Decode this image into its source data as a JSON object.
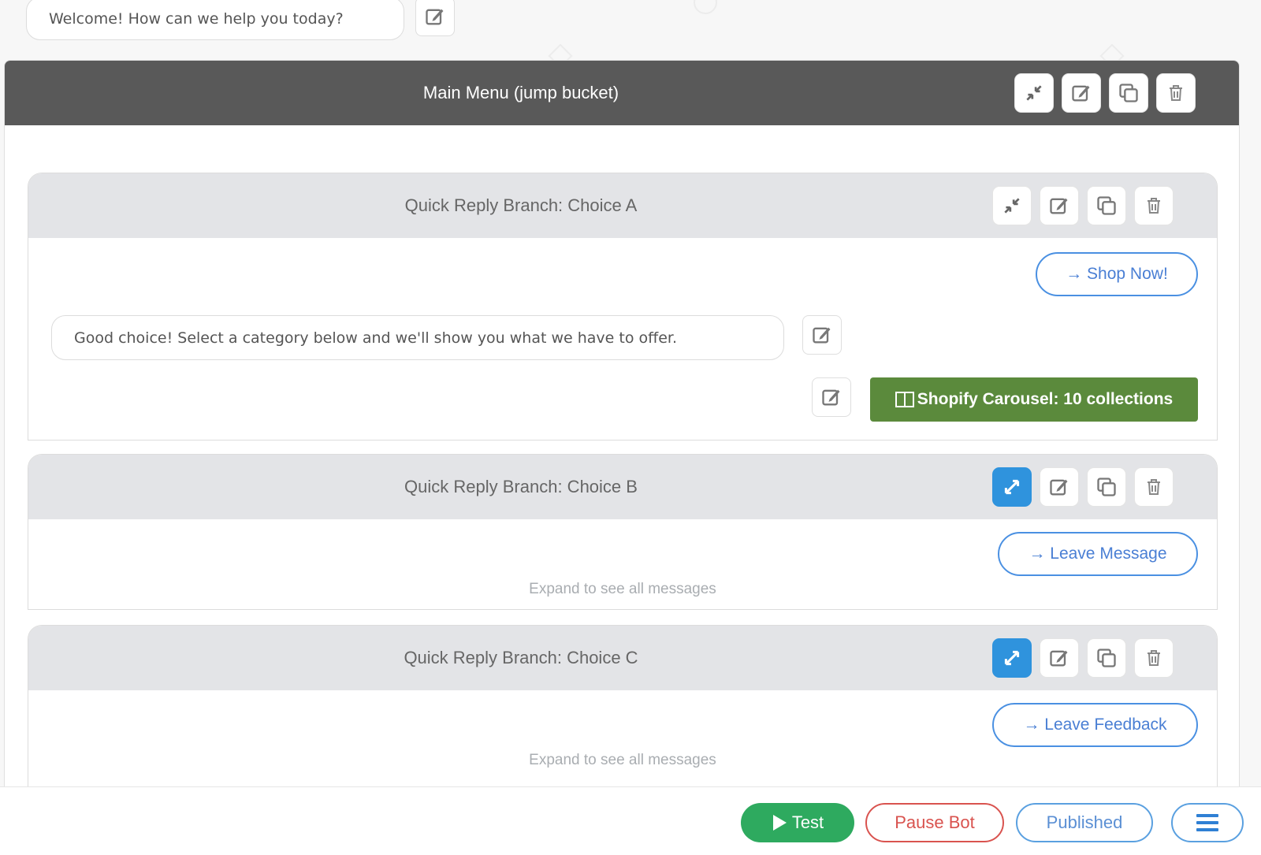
{
  "welcome": {
    "message": "Welcome! How can we help you today?",
    "edit_icon": "edit-icon"
  },
  "main_menu": {
    "title": "Main Menu (jump bucket)",
    "actions": [
      "collapse-icon",
      "edit-icon",
      "copy-icon",
      "trash-icon"
    ]
  },
  "branches": [
    {
      "title": "Quick Reply Branch: Choice A",
      "expanded": true,
      "link_label": "→ Shop Now!",
      "message": "Good choice! Select a category below and we'll show you what we have to offer.",
      "carousel_label": "Shopify Carousel: 10 collections",
      "carousel_icon": "columns-icon"
    },
    {
      "title": "Quick Reply Branch: Choice B",
      "expanded": false,
      "link_label": "→ Leave Message",
      "hint": "Expand to see all messages"
    },
    {
      "title": "Quick Reply Branch: Choice C",
      "expanded": false,
      "link_label": "→ Leave Feedback",
      "hint": "Expand to see all messages"
    }
  ],
  "bottom_bar": {
    "test_label": "Test",
    "pause_label": "Pause Bot",
    "published_label": "Published",
    "menu_icon": "hamburger-icon"
  },
  "colors": {
    "header_dark": "#595959",
    "branch_header": "#e3e4e7",
    "accent_blue": "#2f93dd",
    "link_blue": "#4a90e2",
    "carousel_green": "#5b8a3c",
    "test_green": "#2eaa5f",
    "pause_red": "#d9534f"
  }
}
